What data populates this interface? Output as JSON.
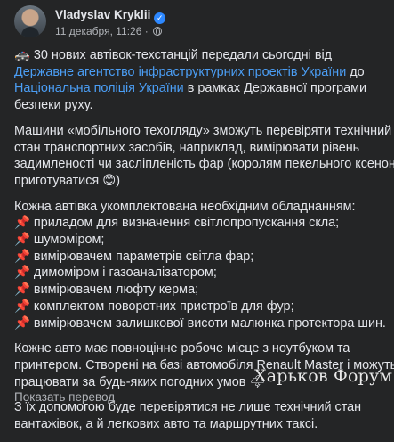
{
  "post": {
    "author": "Vladyslav Kryklii",
    "date": "11 декабря, 11:26 · ",
    "paragraph1": {
      "emoji": "🚓",
      "text_a": " 30 нових автівок-техстанцій передали сьогодні від ",
      "link1": "Державне агентство інфраструктурних проектів України",
      "text_b": " до ",
      "link2": "Національна поліція України",
      "text_c": " в рамках Державної програми безпеки руху."
    },
    "paragraph2_lines": [
      "Машини «мобільного техогляду» зможуть перевіряти технічний",
      "стан транспортних засобів, наприклад, вимірювати рівень",
      "задимленості чи засліпленість фар (королям пекельного ксенону",
      "приготуватися 😊)"
    ],
    "paragraph3_intro": "Кожна автівка укомплектована необхідним обладнанням:",
    "equipment": [
      "приладом для визначення світлопропускання скла;",
      "шумоміром;",
      "вимірювачем параметрів світла фар;",
      "димоміром і газоаналізатором;",
      "вимірювачем люфту керма;",
      "комплектом поворотних пристроїв для фур;",
      "вимірювачем залишкової висоти малюнка протектора шин."
    ],
    "pin_emoji": "📌",
    "paragraph4_lines": [
      "Кожне авто має повноцінне робоче місце з ноутбуком та",
      "принтером. Створені на базі автомобіля Renault Master і можуть",
      "працювати за будь-яких погодних умов 🌩"
    ],
    "paragraph5_lines": [
      "З їх допомогою буде перевірятися не лише технічний стан",
      "вантажівок, а й легкових авто та маршрутних таксі."
    ],
    "translate_label": "Показать перевод",
    "watermark": "Харьков Форум"
  }
}
